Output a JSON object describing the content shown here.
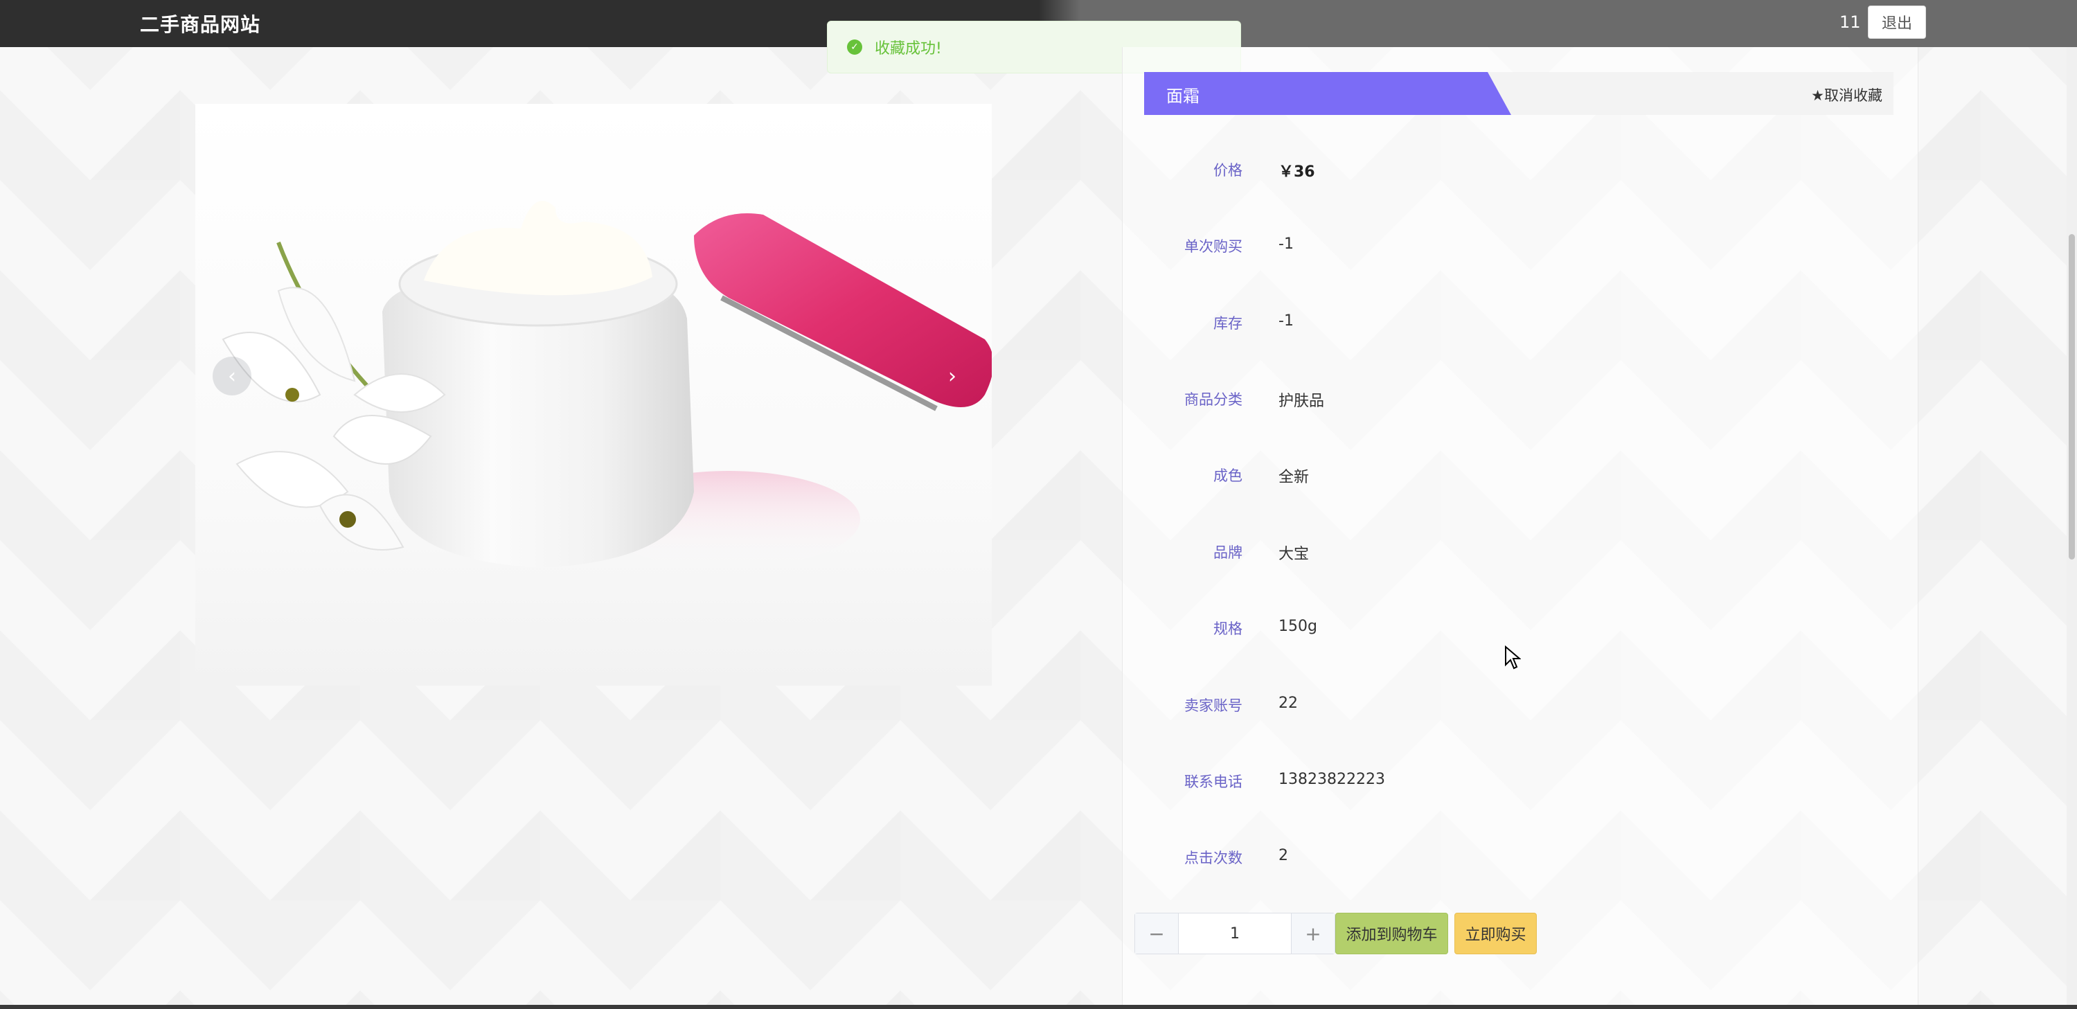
{
  "header": {
    "site_title": "二手商品网站",
    "user_id": "11",
    "logout_label": "退出"
  },
  "toast": {
    "icon": "check-circle-icon",
    "message": "收藏成功!"
  },
  "product": {
    "name": "面霜",
    "unfavorite_label": "取消收藏",
    "details": [
      {
        "label": "价格",
        "value": "￥36"
      },
      {
        "label": "单次购买",
        "value": "-1"
      },
      {
        "label": "库存",
        "value": "-1"
      },
      {
        "label": "商品分类",
        "value": "护肤品"
      },
      {
        "label": "成色",
        "value": "全新"
      },
      {
        "label": "品牌",
        "value": "大宝"
      },
      {
        "label": "规格",
        "value": "150g"
      },
      {
        "label": "卖家账号",
        "value": "22"
      },
      {
        "label": "联系电话",
        "value": "13823822223"
      },
      {
        "label": "点击次数",
        "value": "2"
      }
    ]
  },
  "purchase": {
    "quantity": "1",
    "minus": "−",
    "plus": "+",
    "add_to_cart": "添加到购物车",
    "buy_now": "立即购买"
  },
  "colors": {
    "accent": "#7b6cf6",
    "label_text": "#6a63c7",
    "cart_button": "#b3cf6b",
    "buy_button": "#f7cf63",
    "success": "#67c23a"
  }
}
